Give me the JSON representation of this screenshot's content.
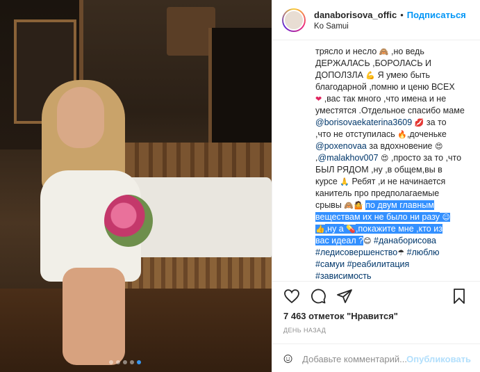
{
  "post": {
    "photo": {
      "carousel_dots": 5,
      "active_dot": 4
    },
    "header": {
      "username": "danaborisova_offic",
      "separator": "•",
      "follow_label": "Подписаться",
      "location": "Ko Samui"
    },
    "caption_lines": {
      "l1": "трясло и несло",
      "l1b": ",но ведь",
      "l2": "ДЕРЖАЛАСЬ ,БОРОЛАСЬ И",
      "l3": "ДОПОЛЗЛА",
      "l3b": "Я умею быть",
      "l4": "благодарной ,помню и ценю ВСЕХ",
      "l5": ",вас так много ,что имена и не",
      "l6": "уместятся .Отдельное спасибо маме",
      "l7_mention": "@borisovaekaterina3609",
      "l7b": "за то",
      "l8": ",что не отступилась",
      "l8b": ",доченьке",
      "l9_mention": "@poxenovaa",
      "l9b": "за вдохновение",
      "l10_mention": "@malakhov007",
      "l10b": ",просто за то ,что",
      "l11": "БЫЛ РЯДОМ ,ну ,в общем,вы в",
      "l12": "курсе",
      "l12b": "Ребят ,и не начинается",
      "l13": "канитель про предполагаемые",
      "l14": "срывы",
      "l14_hl": "по двум главным",
      "l15_hl": "веществам их не было ни разу",
      "l16_hl": ",ну а",
      "l16_hl2": ",покажите мне ,кто из",
      "l17_hl": "вас идеал ?",
      "l17_tag": "#данаборисова",
      "l18_tag": "#ледисовершенство",
      "l18_tag2": "#люблю",
      "l19_tag": "#самуи",
      "l19_tag2": "#реабилитация",
      "l20_tag": "#зависимость"
    },
    "likes": {
      "count": "7 463 отметок",
      "suffix": "\"Нравится\""
    },
    "time_label": "ДЕНЬ НАЗАД",
    "comment": {
      "placeholder": "Добавьте комментарий...",
      "publish_label": "Опубликовать"
    },
    "icons": {
      "like": "heart-icon",
      "comment": "comment-icon",
      "share": "share-icon",
      "save": "bookmark-icon",
      "emoji": "smile-icon"
    },
    "colors": {
      "follow": "#0095f6",
      "mention": "#00376b",
      "highlight": "#3390ff",
      "muted": "#8e8e8e"
    }
  }
}
